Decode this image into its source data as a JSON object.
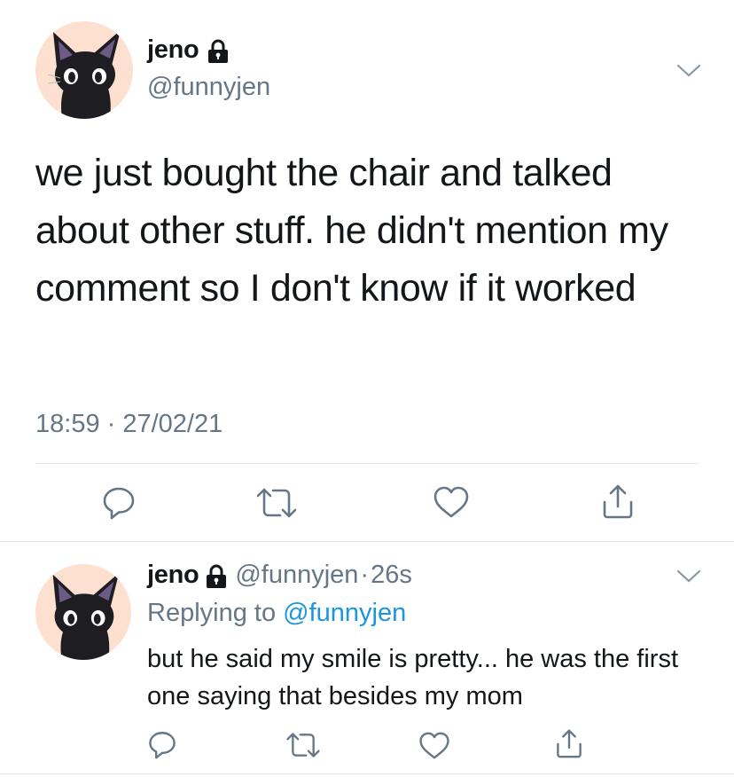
{
  "main_tweet": {
    "display_name": "jeno",
    "handle": "@funnyjen",
    "text": "we just bought the chair and talked about other stuff. he didn't mention my comment so I don't know if it worked",
    "timestamp": "18:59 · 27/02/21"
  },
  "reply_tweet": {
    "display_name": "jeno",
    "handle": "@funnyjen",
    "separator": "·",
    "age": "26s",
    "replying_prefix": "Replying to",
    "replying_to": "@funnyjen",
    "text": "but he said my smile is pretty... he was the first one saying that besides my mom"
  },
  "icons": {
    "lock": "lock-icon",
    "chevron": "chevron-down-icon",
    "reply": "reply-icon",
    "retweet": "retweet-icon",
    "like": "heart-icon",
    "share": "share-icon"
  },
  "colors": {
    "text": "#14171a",
    "secondary": "#657786",
    "link": "#1b95e0",
    "avatar_bg": "#fde0cf",
    "divider": "#e1e8ed"
  }
}
